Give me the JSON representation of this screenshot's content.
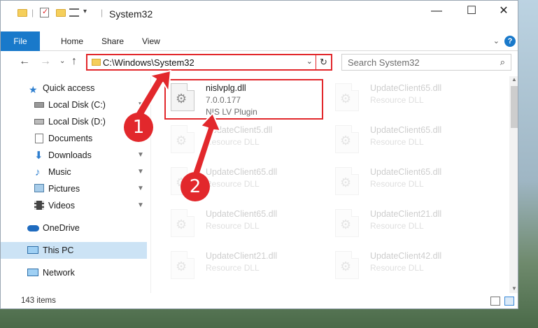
{
  "window": {
    "title": "System32",
    "controls": {
      "minimize": "—",
      "maximize": "☐",
      "close": "✕"
    }
  },
  "ribbon": {
    "file_tab": "File",
    "tabs": [
      "Home",
      "Share",
      "View"
    ],
    "expand": "⌄",
    "help": "?"
  },
  "nav": {
    "address_path": "C:\\Windows\\System32",
    "address_dropdown": "⌄",
    "refresh_icon": "↻",
    "search_placeholder": "Search System32",
    "search_icon": "⌕"
  },
  "sidebar": {
    "items": [
      {
        "label": "Quick access",
        "icon": "star-icon",
        "pinned": false
      },
      {
        "label": "Local Disk (C:)",
        "icon": "drive-icon",
        "pinned": true
      },
      {
        "label": "Local Disk (D:)",
        "icon": "drive-icon",
        "pinned": false
      },
      {
        "label": "Documents",
        "icon": "documents-icon",
        "pinned": true
      },
      {
        "label": "Downloads",
        "icon": "download-icon",
        "pinned": true
      },
      {
        "label": "Music",
        "icon": "music-icon",
        "pinned": true
      },
      {
        "label": "Pictures",
        "icon": "pictures-icon",
        "pinned": true
      },
      {
        "label": "Videos",
        "icon": "videos-icon",
        "pinned": true
      },
      {
        "label": "OneDrive",
        "icon": "cloud-icon",
        "pinned": false
      },
      {
        "label": "This PC",
        "icon": "computer-icon",
        "pinned": false,
        "selected": true
      },
      {
        "label": "Network",
        "icon": "network-icon",
        "pinned": false
      }
    ],
    "pin_glyph": "📌"
  },
  "files": {
    "highlighted": {
      "name": "nislvplg.dll",
      "version": "7.0.0.177",
      "description": "NIS LV Plugin"
    },
    "faded": [
      {
        "name": "UpdateClient65.dll",
        "description": "Resource DLL"
      },
      {
        "name": "UpdateClient5.dll",
        "description": "Resource DLL"
      },
      {
        "name": "UpdateClient65.dll",
        "description": "Resource DLL"
      },
      {
        "name": "UpdateClient65.dll",
        "description": "Resource DLL"
      },
      {
        "name": "UpdateClient65.dll",
        "description": "Resource DLL"
      },
      {
        "name": "UpdateClient65.dll",
        "description": "Resource DLL"
      },
      {
        "name": "UpdateClient21.dll",
        "description": "Resource DLL"
      },
      {
        "name": "UpdateClient21.dll",
        "description": "Resource DLL"
      },
      {
        "name": "UpdateClient42.dll",
        "description": "Resource DLL"
      }
    ]
  },
  "status": {
    "item_count": "143 items"
  },
  "annotations": {
    "marker1": "1",
    "marker2": "2"
  },
  "colors": {
    "accent": "#1979ca",
    "highlight": "#e2282c",
    "selected_bg": "#cce3f5"
  }
}
